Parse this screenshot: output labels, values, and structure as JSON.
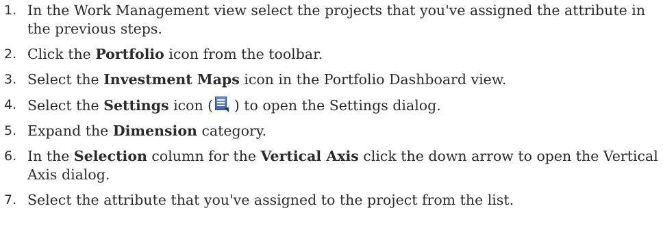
{
  "steps": [
    {
      "num": "1.",
      "parts": [
        {
          "t": "In the Work Management view select the projects that you've assigned the attribute in the previous steps.",
          "b": false
        }
      ]
    },
    {
      "num": "2.",
      "parts": [
        {
          "t": "Click the ",
          "b": false
        },
        {
          "t": "Portfolio",
          "b": true
        },
        {
          "t": " icon from the toolbar.",
          "b": false
        }
      ]
    },
    {
      "num": "3.",
      "parts": [
        {
          "t": "Select the ",
          "b": false
        },
        {
          "t": "Investment Maps",
          "b": true
        },
        {
          "t": " icon in the Portfolio Dashboard view.",
          "b": false
        }
      ]
    },
    {
      "num": "4.",
      "parts": [
        {
          "t": "Select the ",
          "b": false
        },
        {
          "t": "Settings",
          "b": true
        },
        {
          "t": " icon (",
          "b": false
        },
        {
          "icon": "settings-icon"
        },
        {
          "t": " ) to open the Settings dialog.",
          "b": false
        }
      ]
    },
    {
      "num": "5.",
      "parts": [
        {
          "t": "Expand the ",
          "b": false
        },
        {
          "t": "Dimension",
          "b": true
        },
        {
          "t": " category.",
          "b": false
        }
      ]
    },
    {
      "num": "6.",
      "parts": [
        {
          "t": "In the ",
          "b": false
        },
        {
          "t": "Selection",
          "b": true
        },
        {
          "t": " column for the ",
          "b": false
        },
        {
          "t": "Vertical Axis",
          "b": true
        },
        {
          "t": " click the down arrow to open the Vertical Axis dialog.",
          "b": false
        }
      ]
    },
    {
      "num": "7.",
      "parts": [
        {
          "t": "Select the attribute that you've assigned to the project from the list.",
          "b": false
        }
      ]
    }
  ]
}
